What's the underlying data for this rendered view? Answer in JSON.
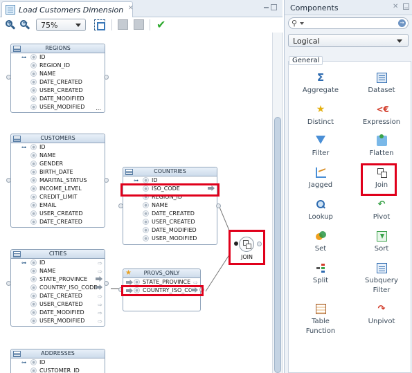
{
  "editor": {
    "tab_title": "Load Customers Dimension",
    "tab_close": "✕",
    "zoom_value": "75%"
  },
  "entities": {
    "regions": {
      "title": "REGIONS",
      "attrs": [
        "ID",
        "REGION_ID",
        "NAME",
        "DATE_CREATED",
        "USER_CREATED",
        "DATE_MODIFIED",
        "USER_MODIFIED"
      ]
    },
    "customers": {
      "title": "CUSTOMERS",
      "attrs": [
        "ID",
        "NAME",
        "GENDER",
        "BIRTH_DATE",
        "MARITAL_STATUS",
        "INCOME_LEVEL",
        "CREDIT_LIMIT",
        "EMAIL",
        "USER_CREATED",
        "DATE_CREATED"
      ]
    },
    "countries": {
      "title": "COUNTRIES",
      "attrs": [
        "ID",
        "ISO_CODE",
        "REGION_ID",
        "NAME",
        "DATE_CREATED",
        "USER_CREATED",
        "DATE_MODIFIED",
        "USER_MODIFIED"
      ]
    },
    "cities": {
      "title": "CITIES",
      "attrs": [
        "ID",
        "NAME",
        "STATE_PROVINCE",
        "COUNTRY_ISO_CODE",
        "DATE_CREATED",
        "USER_CREATED",
        "DATE_MODIFIED",
        "USER_MODIFIED"
      ]
    },
    "provs_only": {
      "title": "PROVS_ONLY",
      "attrs": [
        "STATE_PROVINCE",
        "COUNTRY_ISO_CODE"
      ]
    },
    "addresses": {
      "title": "ADDRESSES",
      "attrs": [
        "ID",
        "CUSTOMER_ID"
      ]
    },
    "more_label": "...",
    "join_label": "JOIN"
  },
  "palette": {
    "title": "Components",
    "close": "✕",
    "search_icon": "🔍",
    "search_go": "→",
    "select_value": "Logical",
    "group": "General",
    "components": [
      {
        "label": "Aggregate",
        "icon": "sigma-icon"
      },
      {
        "label": "Dataset",
        "icon": "dataset-icon"
      },
      {
        "label": "Distinct",
        "icon": "star-icon"
      },
      {
        "label": "Expression",
        "icon": "expression-icon"
      },
      {
        "label": "Filter",
        "icon": "filter-icon"
      },
      {
        "label": "Flatten",
        "icon": "flatten-icon"
      },
      {
        "label": "Jagged",
        "icon": "jagged-icon"
      },
      {
        "label": "Join",
        "icon": "join-icon"
      },
      {
        "label": "Lookup",
        "icon": "lookup-icon"
      },
      {
        "label": "Pivot",
        "icon": "pivot-icon"
      },
      {
        "label": "Set",
        "icon": "set-icon"
      },
      {
        "label": "Sort",
        "icon": "sort-icon"
      },
      {
        "label": "Split",
        "icon": "split-icon"
      },
      {
        "label": "Subquery Filter",
        "icon": "subquery-filter-icon"
      },
      {
        "label": "Table Function",
        "icon": "table-function-icon"
      },
      {
        "label": "Unpivot",
        "icon": "unpivot-icon"
      }
    ],
    "glyphs": {
      "sigma": "Σ",
      "star": "★",
      "expression": "<€",
      "pivot": "↶",
      "unpivot": "↷"
    }
  },
  "colors": {
    "highlight": "#e0001b",
    "accent": "#2e6bb0",
    "check": "#2ea92e"
  }
}
